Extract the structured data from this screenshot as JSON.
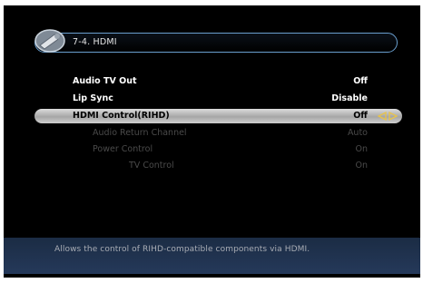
{
  "header": {
    "title": "7-4.  HDMI",
    "icon": "wrench-icon"
  },
  "menu": {
    "items": [
      {
        "label": "Audio  TV  Out",
        "value": "Off",
        "state": "enabled"
      },
      {
        "label": "Lip  Sync",
        "value": "Disable",
        "state": "enabled"
      },
      {
        "label": "HDMI  Control(RIHD)",
        "value": "Off",
        "state": "selected"
      },
      {
        "label": "Audio  Return  Channel",
        "value": "Auto",
        "state": "disabled"
      },
      {
        "label": "Power  Control",
        "value": "On",
        "state": "disabled"
      },
      {
        "label": "TV  Control",
        "value": "On",
        "state": "disabled"
      }
    ]
  },
  "help": {
    "text": "Allows  the  control  of  RIHD-compatible  components  via  HDMI."
  },
  "colors": {
    "accent_border": "#6a9fcf",
    "arrow": "#e8c34a",
    "help_band": "#1b2c44"
  }
}
